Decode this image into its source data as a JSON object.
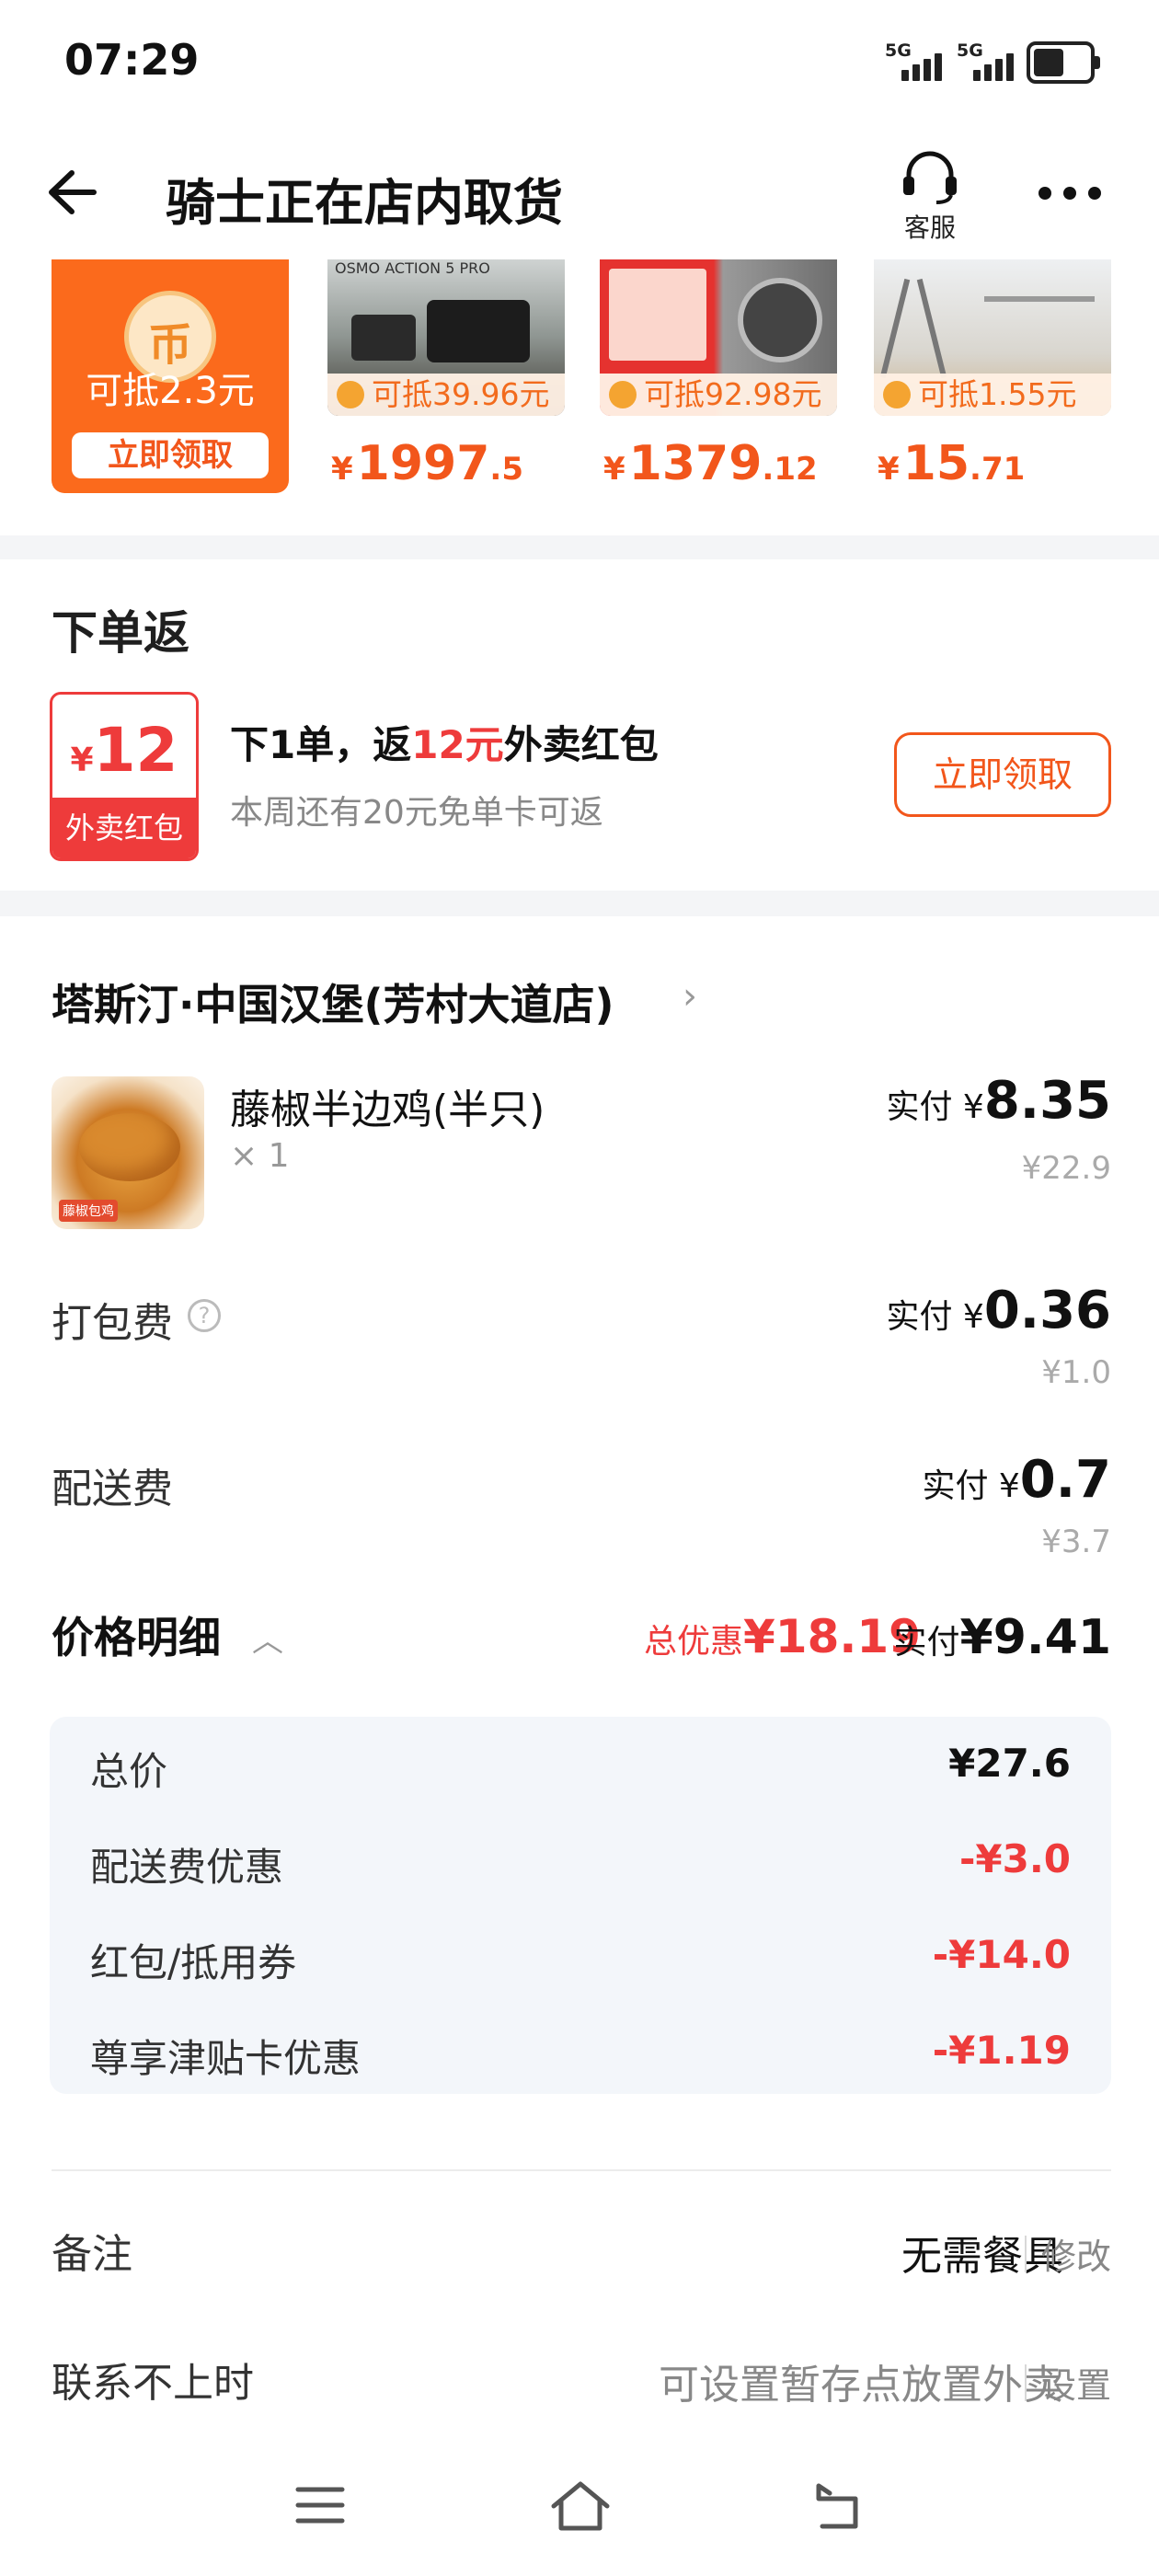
{
  "status_bar": {
    "time": "07:29",
    "network_1": "5G",
    "network_2": "5G"
  },
  "header": {
    "title": "骑士正在店内取货",
    "service_label": "客服"
  },
  "coupon_strip": {
    "main_card": {
      "coin_symbol": "币",
      "text": "可抵2.3元",
      "button": "立即领取"
    },
    "products": [
      {
        "chip": "可抵39.96元",
        "price_symbol": "¥",
        "price_int": "1997",
        "price_dec": ".5",
        "image_text": "OSMO ACTION 5 PRO"
      },
      {
        "chip": "可抵92.98元",
        "price_symbol": "¥",
        "price_int": "1379",
        "price_dec": ".12",
        "image_text": ""
      },
      {
        "chip": "可抵1.55元",
        "price_symbol": "¥",
        "price_int": "15",
        "price_dec": ".71",
        "image_text": ""
      }
    ]
  },
  "order_reward": {
    "title": "下单返",
    "packet_symbol": "¥",
    "packet_amount": "12",
    "packet_label": "外卖红包",
    "line_pre": "下1单，返",
    "line_red": "12元",
    "line_post": "外卖红包",
    "sub": "本周还有20元免单卡可返",
    "button": "立即领取"
  },
  "order": {
    "store": "塔斯汀·中国汉堡(芳村大道店)",
    "item": {
      "name": "藤椒半边鸡(半只)",
      "qty": "× 1",
      "pay_label": "实付 ¥",
      "pay": "8.35",
      "original": "¥22.9",
      "image_tag": "藤椒包鸡"
    },
    "packing": {
      "label": "打包费",
      "pay_label": "实付 ¥",
      "pay": "0.36",
      "original": "¥1.0"
    },
    "delivery": {
      "label": "配送费",
      "pay_label": "实付 ¥",
      "pay": "0.7",
      "original": "¥3.7"
    },
    "detail": {
      "title": "价格明细",
      "discount_label": "总优惠",
      "discount_value": "¥18.19",
      "pay_label": "实付",
      "pay_value": "¥9.41",
      "rows": [
        {
          "label": "总价",
          "value": "¥27.6",
          "color": "#111111"
        },
        {
          "label": "配送费优惠",
          "value": "-¥3.0",
          "color": "#ee3b3b"
        },
        {
          "label": "红包/抵用券",
          "value": "-¥14.0",
          "color": "#ee3b3b"
        },
        {
          "label": "尊享津贴卡优惠",
          "value": "-¥1.19",
          "color": "#ee3b3b"
        }
      ]
    },
    "note": {
      "label": "备注",
      "value": "无需餐具",
      "action": "修改"
    },
    "contact": {
      "label": "联系不上时",
      "value": "可设置暂存点放置外卖",
      "action": "设置"
    }
  },
  "colors": {
    "accent": "#f2561b",
    "red": "#ee3b3b"
  }
}
